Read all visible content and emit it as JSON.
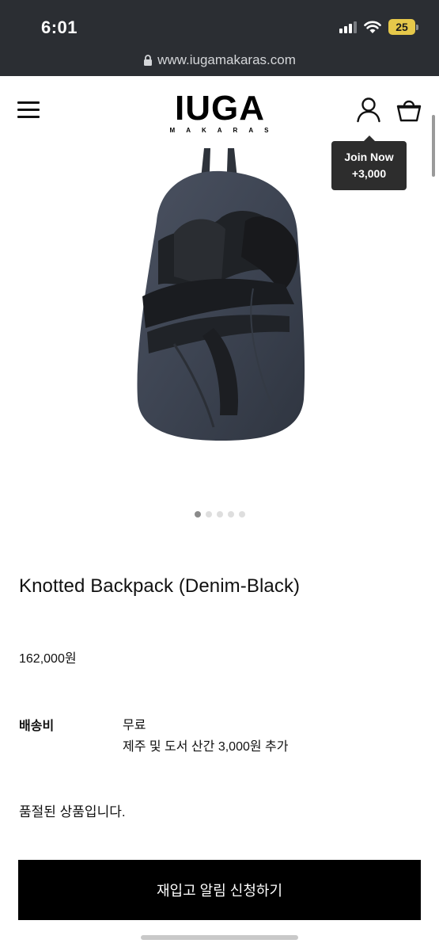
{
  "status_bar": {
    "time": "6:01",
    "battery": "25"
  },
  "browser": {
    "url": "www.iugamakaras.com"
  },
  "header": {
    "logo_main": "IUGA",
    "logo_sub": "MAKARAS",
    "tooltip_line1": "Join Now",
    "tooltip_line2": "+3,000"
  },
  "carousel": {
    "total": 5,
    "active_index": 0
  },
  "product": {
    "title": "Knotted Backpack (Denim-Black)",
    "price": "162,000원",
    "shipping_label": "배송비",
    "shipping_line1": "무료",
    "shipping_line2": "제주 및 도서 산간 3,000원 추가",
    "soldout_text": "품절된 상품입니다.",
    "restock_button": "재입고 알림 신청하기"
  },
  "icons": {
    "menu": "hamburger-menu-icon",
    "user": "user-icon",
    "cart": "shopping-bag-icon",
    "lock": "lock-icon",
    "wifi": "wifi-icon",
    "signal": "cellular-signal-icon",
    "battery": "battery-icon"
  },
  "colors": {
    "chrome_bg": "#2b2e33",
    "battery": "#e6c84a",
    "button_bg": "#000000",
    "tooltip_bg": "#2d2d2d"
  }
}
